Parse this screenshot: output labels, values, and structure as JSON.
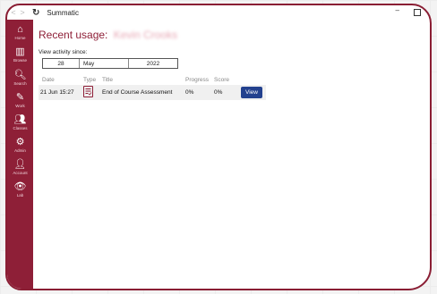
{
  "window": {
    "title": "Summatic",
    "back_glyph": "<",
    "forward_glyph": ">",
    "refresh_glyph": "↻",
    "minimize_glyph": "–"
  },
  "sidebar": {
    "items": [
      {
        "label": "Home",
        "icon": "home-icon",
        "glyph": "⌂"
      },
      {
        "label": "Browse",
        "icon": "book-icon",
        "glyph": "▥"
      },
      {
        "label": "Search",
        "icon": "search-icon",
        "glyph": "🔍︎"
      },
      {
        "label": "Work",
        "icon": "work-icon",
        "glyph": "✎"
      },
      {
        "label": "Classes",
        "icon": "classes-icon",
        "glyph": "👥︎"
      },
      {
        "label": "Admin",
        "icon": "admin-icon",
        "glyph": "⚙"
      },
      {
        "label": "Account",
        "icon": "account-icon",
        "glyph": "👤︎"
      },
      {
        "label": "Lab",
        "icon": "eye-icon",
        "glyph": "👁︎"
      }
    ]
  },
  "main": {
    "heading": "Recent usage:",
    "user_name": "Kevin Crooks",
    "since_label": "View activity since:",
    "date": {
      "day": "28",
      "month": "May",
      "year": "2022"
    },
    "columns": [
      "Date",
      "Type",
      "Title",
      "Progress",
      "Score"
    ],
    "rows": [
      {
        "date": "21 Jun 15:27",
        "type_icon": "assessment-icon",
        "title": "End of Course Assessment",
        "progress": "0%",
        "score": "0%",
        "action": "View"
      }
    ]
  },
  "colors": {
    "brand": "#8e1f37",
    "button": "#23418e"
  }
}
